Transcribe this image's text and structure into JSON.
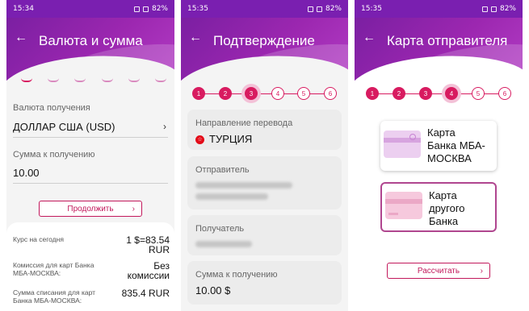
{
  "screen1": {
    "status_time": "15:34",
    "status_battery": "82%",
    "title": "Валюта и сумма",
    "currency_label": "Валюта получения",
    "currency_value": "ДОЛЛАР США (USD)",
    "amount_label": "Сумма к получению",
    "amount_value": "10.00",
    "continue_button": "Продолжить",
    "rate_label": "Курс на сегодня",
    "rate_value": "1 $=83.54 RUR",
    "commission_label": "Комиссия для карт Банка МБА-МОСКВА:",
    "commission_value": "Без комиссии",
    "debit_label": "Сумма списания для карт Банка МБА-МОСКВА:",
    "debit_value": "835.4 RUR"
  },
  "screen2": {
    "status_time": "15:35",
    "status_battery": "82%",
    "title": "Подтверждение",
    "steps": [
      "1",
      "2",
      "3",
      "4",
      "5",
      "6"
    ],
    "current_step": 3,
    "direction_label": "Направление перевода",
    "direction_value": "ТУРЦИЯ",
    "sender_label": "Отправитель",
    "recipient_label": "Получатель",
    "amount_label": "Сумма к получению",
    "amount_value": "10.00 $"
  },
  "screen3": {
    "status_time": "15:35",
    "status_battery": "82%",
    "title": "Карта отправителя",
    "steps": [
      "1",
      "2",
      "3",
      "4",
      "5",
      "6"
    ],
    "current_step": 4,
    "option1": [
      "Карта",
      "Банка МБА-",
      "МОСКВА"
    ],
    "option2": [
      "Карта",
      "другого",
      "Банка"
    ],
    "calculate_button": "Рассчитать"
  },
  "colors": {
    "header": "#8e24aa",
    "accent": "#d81b60"
  }
}
